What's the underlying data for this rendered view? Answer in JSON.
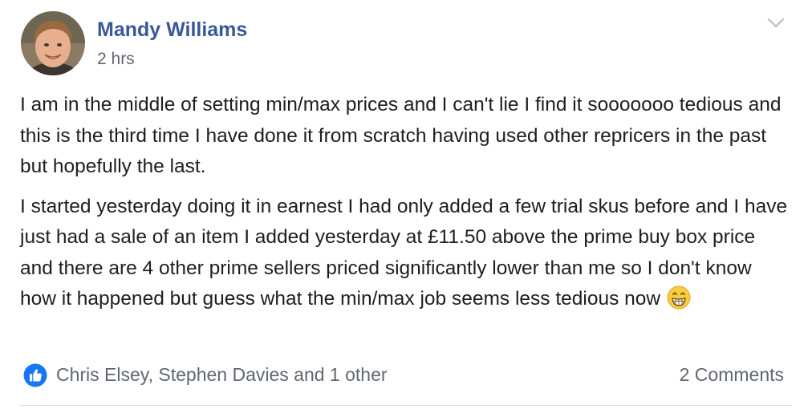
{
  "post": {
    "author_name": "Mandy Williams",
    "timestamp": "2 hrs",
    "avatar": "profile-photo",
    "menu_icon": "chevron-down-icon",
    "paragraphs": [
      "I am in the middle of setting min/max prices and I can't lie I find it sooooooo tedious and this is the third time I have done it from scratch having used other repricers in the past but hopefully the last.",
      "I started yesterday doing it in earnest I had only added a few trial skus before and I have just had a sale of an item I added yesterday at £11.50 above the prime buy box price and there are 4 other prime sellers priced significantly lower than me so I don't know how it happened but guess what the min/max job seems less tedious now"
    ],
    "emoji": "grinning-face-emoji"
  },
  "footer": {
    "reaction_icon": "like-icon",
    "reactors": "Chris Elsey, Stephen Davies and 1 other",
    "comments": "2 Comments"
  },
  "colors": {
    "author": "#385898",
    "meta": "#616770",
    "text": "#1c1e21",
    "like_blue": "#1877f2",
    "divider": "#dadde1"
  }
}
